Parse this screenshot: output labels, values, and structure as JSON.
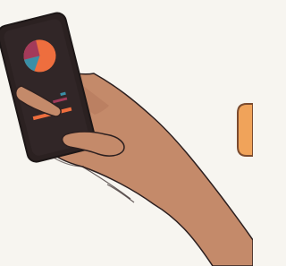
{
  "scene": {
    "background_color": "#f7f5f0",
    "skin_color": "#c48a6a",
    "skin_shadow_color": "#b67a5e",
    "outline_color": "#2c1f1f",
    "phone_body_color": "#2b2121",
    "phone_screen_color": "#312627",
    "pie_colors": [
      "#ee6e3e",
      "#a33a5a",
      "#3a8fa6"
    ],
    "legend_colors": [
      "#3a8fa6",
      "#a33a5a"
    ],
    "bar_color": "#ee6e3e",
    "side_button_color": "#f0a35a",
    "side_button_outline_color": "#7b4b2f"
  },
  "icons": {
    "phone": "phone-icon",
    "pie": "pie-chart-icon"
  }
}
